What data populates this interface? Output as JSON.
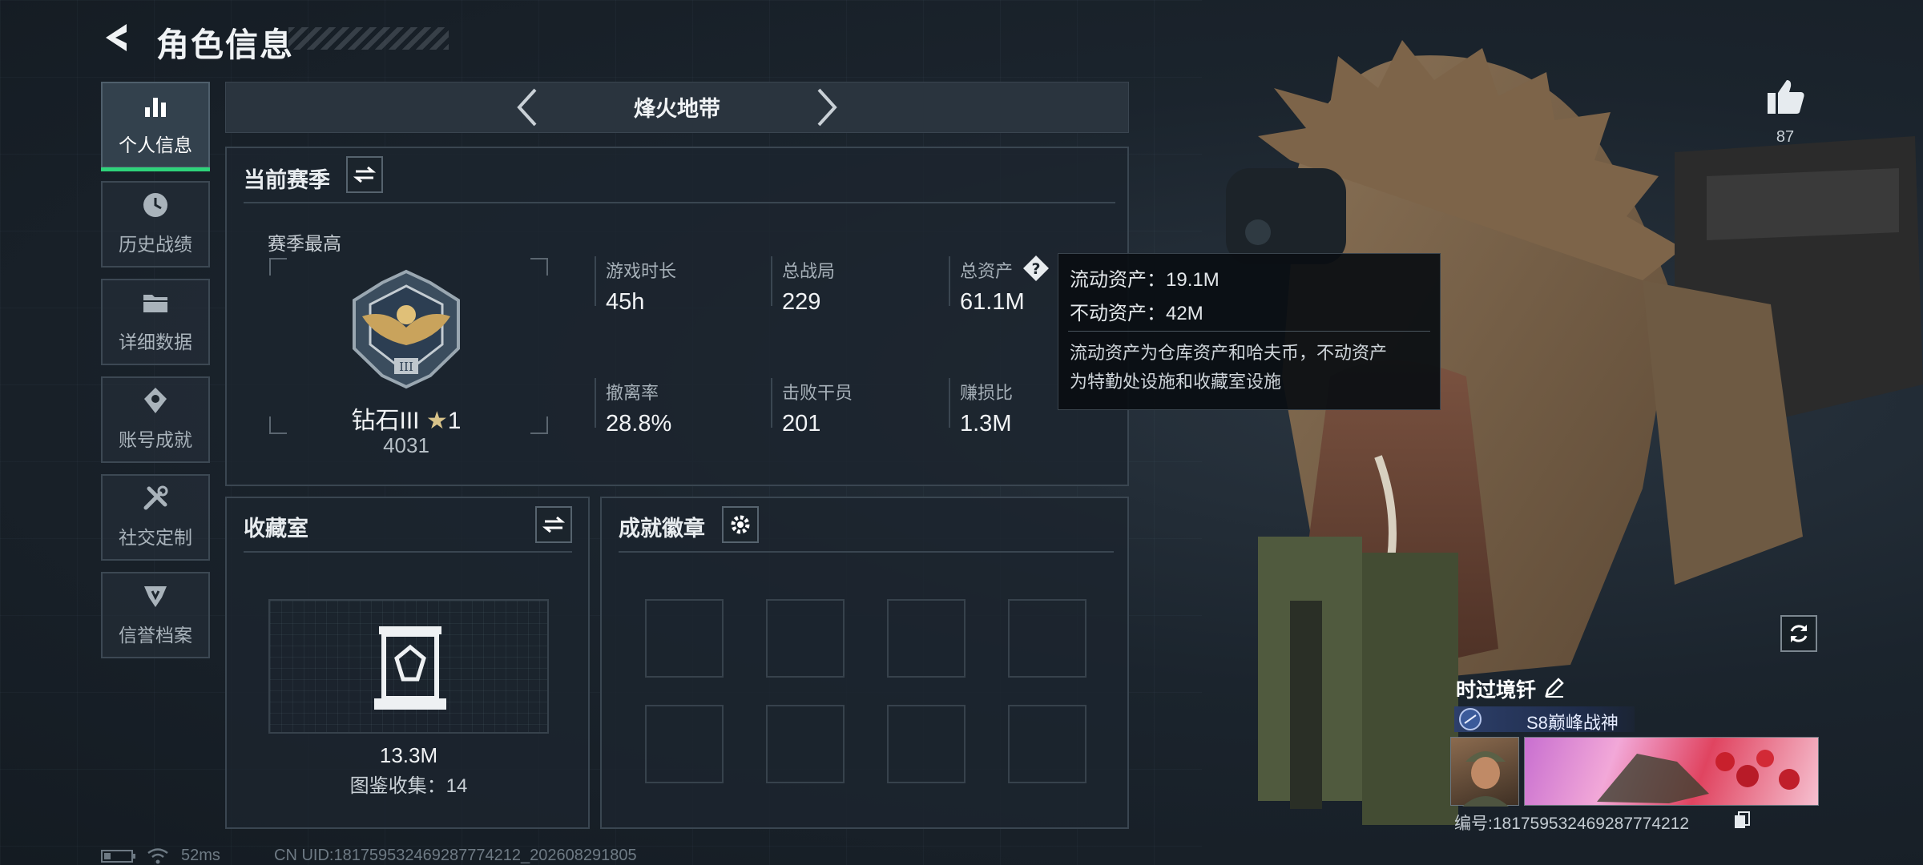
{
  "header": {
    "title": "角色信息"
  },
  "sidebar": {
    "items": [
      {
        "label": "个人信息",
        "icon": "bar-chart-icon",
        "active": true
      },
      {
        "label": "历史战绩",
        "icon": "history-icon",
        "active": false
      },
      {
        "label": "详细数据",
        "icon": "folder-icon",
        "active": false
      },
      {
        "label": "账号成就",
        "icon": "achievement-icon",
        "active": false
      },
      {
        "label": "社交定制",
        "icon": "tools-icon",
        "active": false
      },
      {
        "label": "信誉档案",
        "icon": "reputation-icon",
        "active": false
      }
    ]
  },
  "map_selector": {
    "name": "烽火地带"
  },
  "season_panel": {
    "title": "当前赛季",
    "best_label": "赛季最高",
    "rank_name": "钻石III",
    "rank_stars": "1",
    "rank_score": "4031",
    "stats": [
      {
        "label": "游戏时长",
        "value": "45h"
      },
      {
        "label": "总战局",
        "value": "229"
      },
      {
        "label": "总资产",
        "value": "61.1M"
      },
      {
        "label": "撤离率",
        "value": "28.8%"
      },
      {
        "label": "击败干员",
        "value": "201"
      },
      {
        "label": "赚损比",
        "value": "1.3M"
      }
    ]
  },
  "tooltip": {
    "liquid": "流动资产：19.1M",
    "fixed": "不动资产：42M",
    "desc_line1": "流动资产为仓库资产和哈夫币，不动资产",
    "desc_line2": "为特勤处设施和收藏室设施"
  },
  "collection_panel": {
    "title": "收藏室",
    "value": "13.3M",
    "count_text": "图鉴收集：14"
  },
  "achievement_panel": {
    "title": "成就徽章"
  },
  "profile": {
    "like_count": "87",
    "name": "时过境钎",
    "title": "S8巅峰战神",
    "id_text": "编号:18175953246928​7774212"
  },
  "footer": {
    "ping": "52ms",
    "uid": "CN UID:18175953246928​7774212_202608291805"
  },
  "colors": {
    "accent_green": "#2ed37a",
    "panel_border": "#3a4651",
    "background": "#17202a"
  }
}
